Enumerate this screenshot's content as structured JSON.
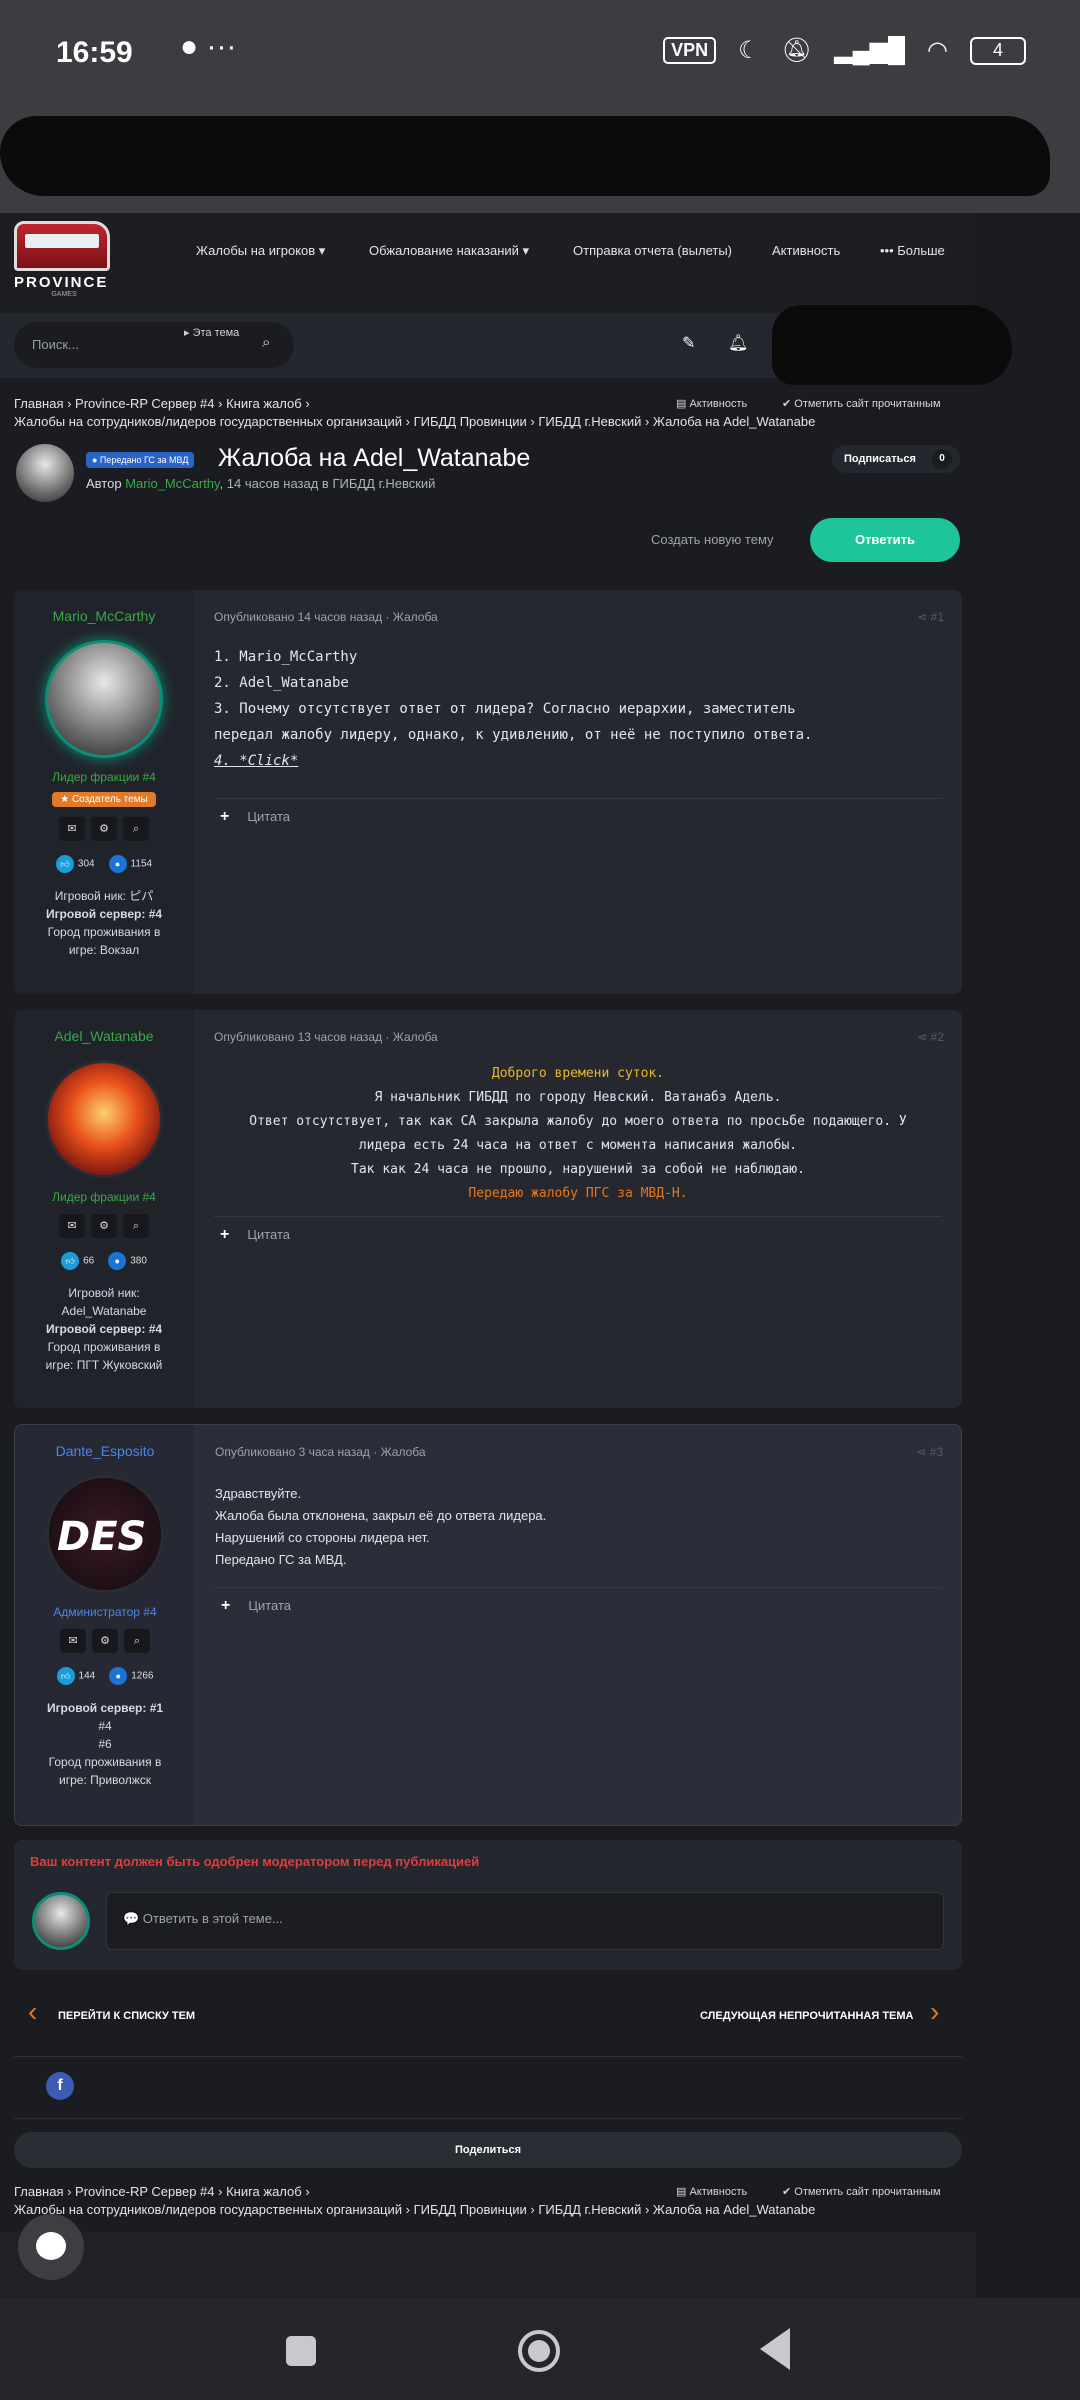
{
  "status": {
    "time": "16:59",
    "vpn": "VPN",
    "battery": "4"
  },
  "logo": {
    "name": "PROVINCE",
    "sub": "GAMES"
  },
  "nav": [
    "Жалобы на игроков ▾",
    "Обжалование наказаний ▾",
    "Отправка отчета (вылеты)",
    "Активность",
    "••• Больше"
  ],
  "search": {
    "placeholder": "Поиск...",
    "scope": "▸ Эта тема"
  },
  "breadcrumb": {
    "line1": "Главная › Province-RP Сервер #4 › Книга жалоб ›",
    "line2": "Жалобы на сотрудников/лидеров государственных организаций › ГИБДД Провинции › ГИБДД г.Невский › Жалоба на Adel_Watanabe",
    "activity": "Активность",
    "mark_read": "✔ Отметить сайт прочитанным"
  },
  "thread": {
    "tag": "● Передано ГС за МВД",
    "title": "Жалоба на Adel_Watanabe",
    "author_prefix": "Автор",
    "author": "Mario_McCarthy",
    "author_suffix": ", 14 часов назад в ГИБДД г.Невский",
    "subscribe": "Подписаться",
    "subscribe_count": "0",
    "create_topic": "Создать новую тему",
    "reply": "Ответить"
  },
  "posts": [
    {
      "user": "Mario_McCarthy",
      "user_color": "#3aa847",
      "role": "Лидер фракции #4",
      "badge": "★ Создатель темы",
      "likes": "304",
      "messages": "1154",
      "info": [
        "Игровой ник: ピパ",
        "Игровой сервер: #4",
        "Город проживания в",
        "игре: Вокзал"
      ],
      "meta": "Опубликовано 14 часов назад · Жалоба",
      "num": "#1",
      "lines": [
        "1. Mario_McCarthy",
        "2. Adel_Watanabe",
        "3. Почему отсутствует ответ от лидера? Согласно иерархии, заместитель",
        "передал жалобу лидеру, однако, к удивлению, от неё не поступило ответа.",
        "4. *Click*"
      ],
      "quote": "Цитата"
    },
    {
      "user": "Adel_Watanabe",
      "user_color": "#3aa847",
      "role": "Лидер фракции #4",
      "likes": "66",
      "messages": "380",
      "info": [
        "Игровой ник:",
        "Adel_Watanabe",
        "Игровой сервер: #4",
        "Город проживания в",
        "игре: ПГТ Жуковский"
      ],
      "meta": "Опубликовано 13 часов назад · Жалоба",
      "num": "#2",
      "lines": [
        "Доброго времени суток.",
        "Я начальник ГИБДД по городу Невский. Ватанабэ Адель.",
        "Ответ отсутствует, так как СА закрыла жалобу до моего ответа по просьбе подающего. У",
        "лидера есть 24 часа на ответ с момента написания жалобы.",
        "Так как 24 часа не прошло, нарушений за собой не наблюдаю.",
        "Передаю жалобу ПГС за МВД-Н."
      ],
      "quote": "Цитата"
    },
    {
      "user": "Dante_Esposito",
      "user_color": "#4a86e8",
      "role": "Администратор #4",
      "likes": "144",
      "messages": "1266",
      "info": [
        "Игровой сервер: #1",
        "#4",
        "#6",
        "Город проживания в",
        "игре: Приволжск"
      ],
      "meta": "Опубликовано 3 часа назад · Жалоба",
      "num": "#3",
      "lines": [
        "Здравствуйте.",
        "Жалоба была отклонена, закрыл её до ответа лидера.",
        "Нарушений со стороны лидера нет.",
        "Передано ГС за МВД."
      ],
      "quote": "Цитата"
    }
  ],
  "reply_box": {
    "warning": "Ваш контент должен быть одобрен модератором перед публикацией",
    "placeholder": "💬 Ответить в этой теме..."
  },
  "pager": {
    "prev": "ПЕРЕЙТИ К СПИСКУ ТЕМ",
    "next": "СЛЕДУЮЩАЯ НЕПРОЧИТАННАЯ ТЕМА"
  },
  "share": "Поделиться"
}
